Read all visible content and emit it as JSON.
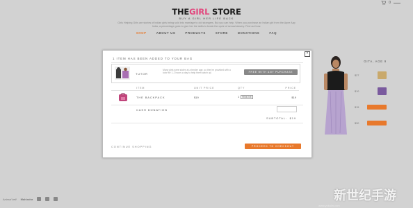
{
  "cart": {
    "count": "0"
  },
  "header": {
    "logo_part1": "THE",
    "logo_part2": "GIRL",
    "logo_part3": " STORE",
    "tagline": "BUY A GIRL HER LIFE BACK",
    "intro": "Girls Helping Girls are stories of indian girls being sold into marriage to old strangers. But you can help. When you purchase an Indian girl from the Apne Aap India, a percentage goes to give her the skills to break the cycle of sexual slavery. Find out how."
  },
  "nav": {
    "items": [
      {
        "label": "SHOP",
        "active": true
      },
      {
        "label": "ABOUT US",
        "active": false
      },
      {
        "label": "PRODUCTS",
        "active": false
      },
      {
        "label": "STORE",
        "active": false
      },
      {
        "label": "DONATIONS",
        "active": false
      },
      {
        "label": "FAQ",
        "active": false
      }
    ]
  },
  "side_panel": {
    "title": "GITA, AGE 9",
    "rows": [
      {
        "price": "$27",
        "thumb_color": "#c9a96c"
      },
      {
        "price": "$10",
        "thumb_color": "#7a5a9e"
      },
      {
        "price": "$15",
        "button": true
      },
      {
        "price": "$30",
        "button": true
      }
    ]
  },
  "modal": {
    "added_message": "1 ITEM HAS BEEN ADDED TO YOUR BAG",
    "close": "×",
    "tutor": {
      "label": "TUTOR",
      "description": "Many girls were stolen at a tender age, so they're provided with a tutor for 1-2 hours a day to help them catch up.",
      "button": "FREE WITH ANY PURCHASE"
    },
    "table_headers": {
      "item": "ITEM",
      "unit_price": "UNIT PRICE",
      "qty": "QTY",
      "price": "PRICE"
    },
    "item": {
      "name": "THE BACKPACK",
      "unit_price": "$19",
      "qty": "1",
      "remove": "REMOVE",
      "total": "$19"
    },
    "cash_donation": "CASH DONATION",
    "subtotal_label": "SUBTOTAL:",
    "subtotal_value": "$19",
    "continue": "CONTINUE SHOPPING",
    "checkout": "PROCEED TO CHECKOUT"
  },
  "footer": {
    "brand": "Animal bell",
    "partner": "Mahindra"
  },
  "watermark": {
    "text": "新世纪手游",
    "small": "www.yokolin.com"
  }
}
